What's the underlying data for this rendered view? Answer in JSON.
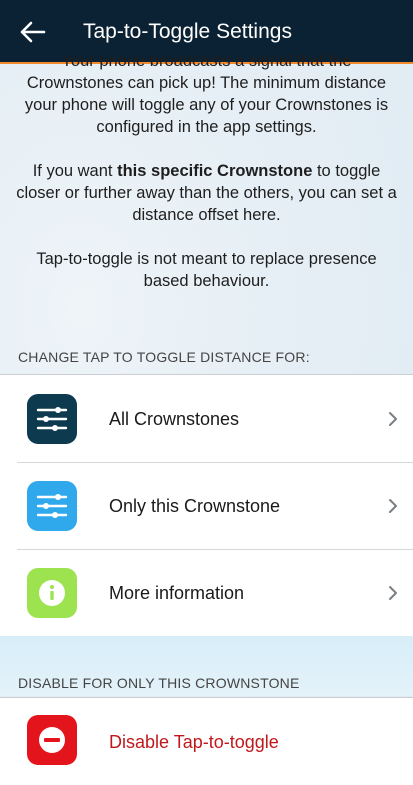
{
  "header": {
    "title": "Tap-to-Toggle Settings",
    "back_icon": "back-arrow-icon"
  },
  "intro": {
    "paragraph1": "Your phone broadcasts a signal that the Crownstones can pick up! The minimum distance your phone will toggle any of your Crownstones is configured in the app settings.",
    "paragraph2_before": "If you want ",
    "paragraph2_bold": "this specific Crownstone",
    "paragraph2_after": " to toggle closer or further away than the others, you can set a distance offset here.",
    "paragraph3": "Tap-to-toggle is not meant to replace presence based behaviour."
  },
  "distance_section": {
    "header": "CHANGE TAP TO TOGGLE DISTANCE FOR:",
    "items": [
      {
        "label": "All Crownstones",
        "icon": "sliders-icon",
        "color": "#0e3a4f"
      },
      {
        "label": "Only this Crownstone",
        "icon": "sliders-icon",
        "color": "#2fa8ec"
      },
      {
        "label": "More information",
        "icon": "info-icon",
        "color": "#9ce34f"
      }
    ]
  },
  "disable_section": {
    "header": "DISABLE FOR ONLY THIS CROWNSTONE",
    "items": [
      {
        "label": "Disable Tap-to-toggle",
        "icon": "minus-circle-icon",
        "color": "#e4141c",
        "text_color": "#c0191c"
      }
    ]
  },
  "colors": {
    "topbar": "#0a2233",
    "accent": "#f08a2c"
  }
}
